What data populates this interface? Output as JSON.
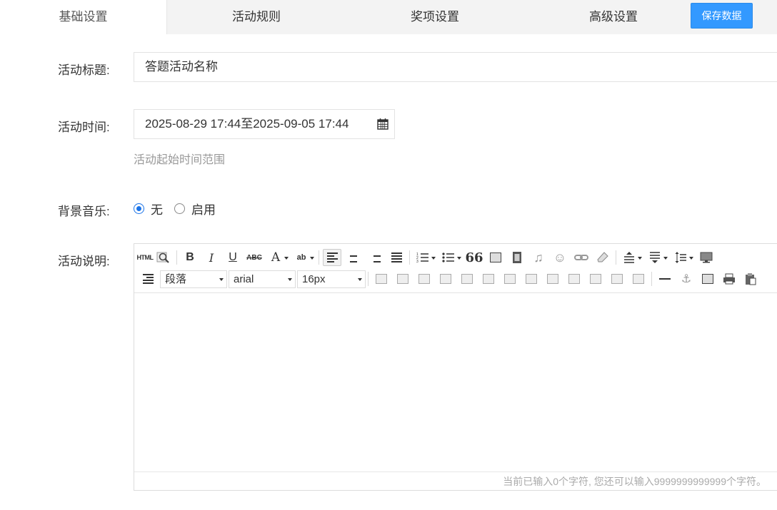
{
  "tabs": [
    {
      "label": "基础设置",
      "active": true
    },
    {
      "label": "活动规则",
      "active": false
    },
    {
      "label": "奖项设置",
      "active": false
    },
    {
      "label": "高级设置",
      "active": false
    }
  ],
  "save_label": "保存数据",
  "form": {
    "title_label": "活动标题:",
    "title_value": "答题活动名称",
    "time_label": "活动时间:",
    "time_value": "2025-08-29 17:44至2025-09-05 17:44",
    "time_hint": "活动起始时间范围",
    "music_label": "背景音乐:",
    "music_options": [
      {
        "label": "无",
        "checked": true
      },
      {
        "label": "启用",
        "checked": false
      }
    ],
    "desc_label": "活动说明:"
  },
  "editor": {
    "html_btn": "HTML",
    "bold": "B",
    "italic": "I",
    "underline": "U",
    "strike": "ABC",
    "font_color": "A",
    "highlight": "ab",
    "quote": "66",
    "paragraph": "段落",
    "font_family": "arial",
    "font_size": "16px",
    "counter_text": "当前已输入0个字符, 您还可以输入9999999999999个字符。"
  }
}
